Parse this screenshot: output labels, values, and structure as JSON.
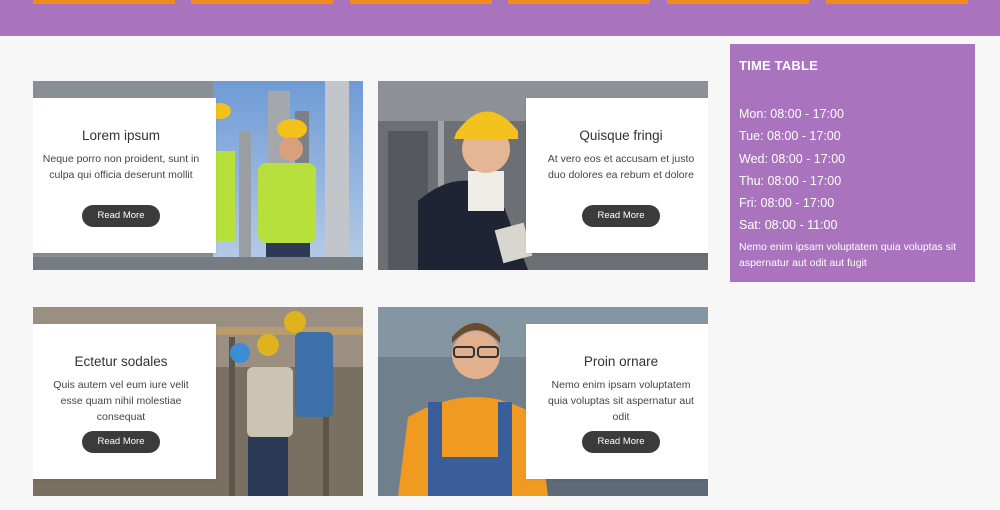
{
  "colors": {
    "accent": "#a973be",
    "nav_tab": "#f28a1c",
    "button": "#3b3b3b"
  },
  "cards": [
    {
      "title": "Lorem ipsum",
      "text": "Neque porro non proident, sunt in culpa qui officia deserunt mollit",
      "button": "Read More"
    },
    {
      "title": "Quisque fringi",
      "text": "At vero eos et accusam et justo duo dolores ea rebum et dolore",
      "button": "Read More"
    },
    {
      "title": "Ectetur sodales",
      "text": "Quis autem vel eum iure velit esse quam nihil molestiae consequat",
      "button": "Read More"
    },
    {
      "title": "Proin ornare",
      "text": "Nemo enim ipsam voluptatem quia voluptas sit aspernatur aut odit",
      "button": "Read More"
    }
  ],
  "timetable": {
    "title": "TIME TABLE",
    "rows": [
      "Mon: 08:00 - 17:00",
      "Tue: 08:00 - 17:00",
      "Wed: 08:00 - 17:00",
      "Thu: 08:00 - 17:00",
      "Fri: 08:00 - 17:00",
      "Sat: 08:00 - 11:00"
    ],
    "note": "Nemo enim ipsam voluptatem quia voluptas sit aspernatur aut odit aut fugit"
  }
}
